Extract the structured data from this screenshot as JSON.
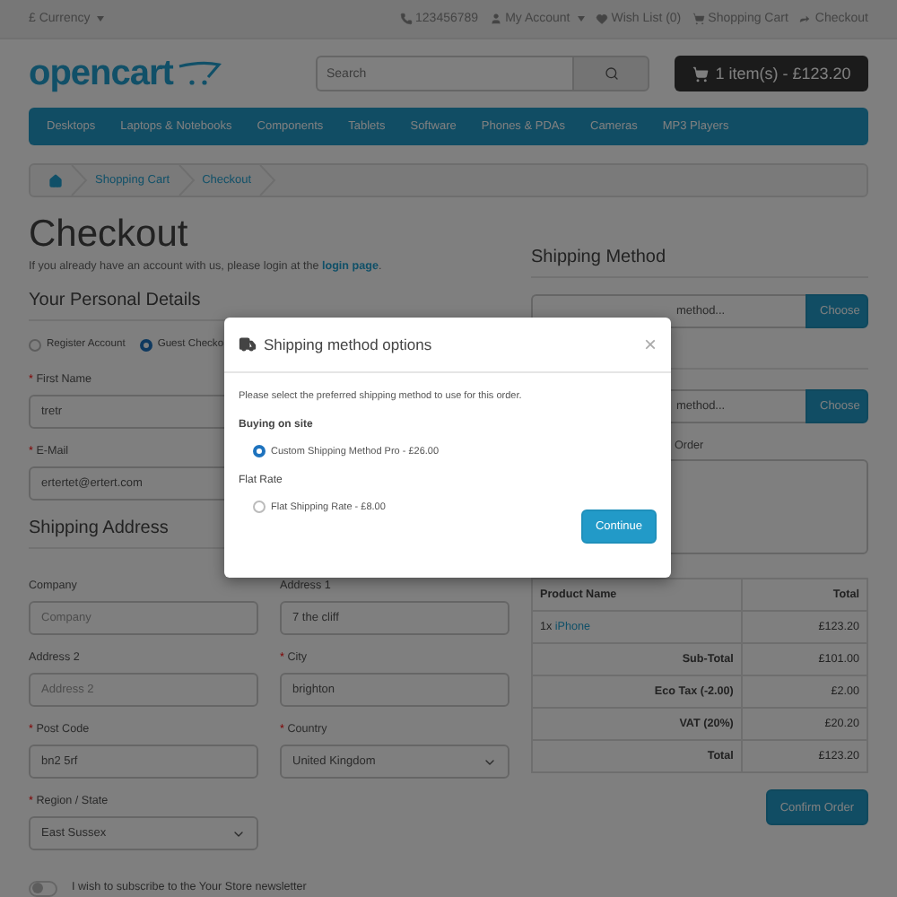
{
  "top_bar": {
    "currency": "£ Currency",
    "links": [
      {
        "label": "123456789",
        "dropdown": false
      },
      {
        "label": "My Account",
        "dropdown": true
      },
      {
        "label": "Wish List (0)",
        "dropdown": false
      },
      {
        "label": "Shopping Cart",
        "dropdown": false
      },
      {
        "label": "Checkout",
        "dropdown": false
      }
    ]
  },
  "header": {
    "logo": "opencart",
    "search": {
      "placeholder": "Search"
    },
    "cart": "1 item(s) - £123.20"
  },
  "nav": [
    "Desktops",
    "Laptops & Notebooks",
    "Components",
    "Tablets",
    "Software",
    "Phones & PDAs",
    "Cameras",
    "MP3 Players"
  ],
  "breadcrumb": [
    "Shopping Cart",
    "Checkout"
  ],
  "title": "Checkout",
  "intro": {
    "before": "If you already have an account with us, please login at the",
    "link": "login page",
    "after": "."
  },
  "personal_details": {
    "heading": "Your Personal Details",
    "account_options": [
      {
        "label": "Register Account",
        "selected": false
      },
      {
        "label": "Guest Checko",
        "selected": true
      }
    ],
    "fields": [
      {
        "label": "First Name",
        "mark": "*",
        "value": "tretr"
      },
      {
        "label": "E-Mail",
        "mark": "*",
        "value": "ertertet@ertert.com"
      }
    ]
  },
  "shipping_address": {
    "heading": "Shipping Address",
    "fields": [
      {
        "label": "Company",
        "placeholder": "Company",
        "kind": "text"
      },
      {
        "label": "Address 1",
        "value": "7 the cliff",
        "kind": "text"
      },
      {
        "label": "Address 2",
        "placeholder": "Address 2",
        "kind": "text"
      },
      {
        "label": "City",
        "mark": "*",
        "value": "brighton",
        "kind": "text"
      },
      {
        "label": "Post Code",
        "mark": "*",
        "value": "bn2 5rf",
        "kind": "text"
      },
      {
        "label": "Country",
        "mark": "*",
        "value": "United Kingdom",
        "kind": "select"
      },
      {
        "label": "Region / State",
        "mark": "*",
        "value": "East Sussex",
        "kind": "select"
      }
    ]
  },
  "newsletter": {
    "label": "I wish to subscribe to the Your Store newsletter",
    "on": false
  },
  "shipping_method": {
    "heading": "Shipping Method",
    "inputs": [
      {
        "value": "method...",
        "button": "Choose"
      },
      {
        "value": "method...",
        "button": "Choose"
      }
    ]
  },
  "comment": {
    "label": "Order"
  },
  "order_table": {
    "columns": [
      "Product Name",
      "Total"
    ],
    "items": [
      {
        "quantity": "1x",
        "name": "iPhone",
        "total": "£123.20"
      }
    ],
    "totals": [
      {
        "label": "Sub-Total",
        "value": "£101.00"
      },
      {
        "label": "Eco Tax (-2.00)",
        "value": "£2.00"
      },
      {
        "label": "VAT (20%)",
        "value": "£20.20"
      },
      {
        "label": "Total",
        "value": "£123.20"
      }
    ]
  },
  "confirm_button": "Confirm Order",
  "modal": {
    "title": "Shipping method options",
    "close": "×",
    "intro": "Please select the preferred shipping method to use for this order.",
    "groups": [
      {
        "title": "Buying on site",
        "bold": true,
        "options": [
          {
            "label": "Custom Shipping Method Pro - £26.00",
            "selected": true
          }
        ]
      },
      {
        "title": "Flat Rate",
        "bold": false,
        "options": [
          {
            "label": "Flat Shipping Rate - £8.00",
            "selected": false
          }
        ]
      }
    ],
    "button": "Continue"
  }
}
